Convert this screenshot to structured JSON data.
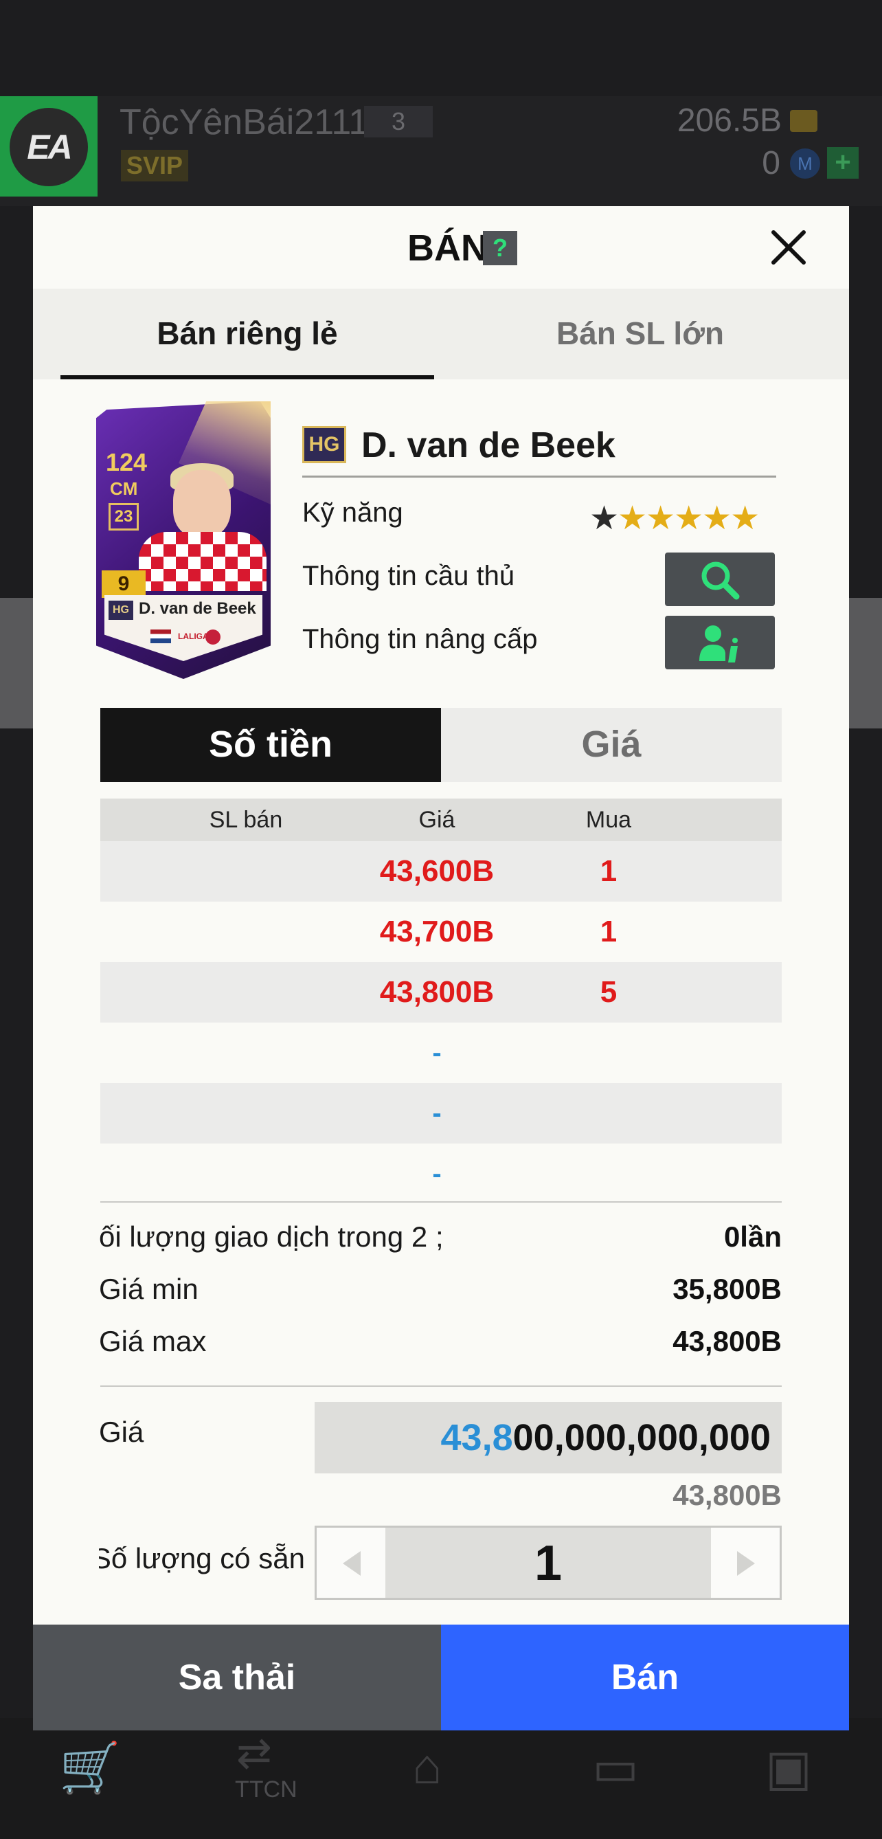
{
  "background": {
    "username": "TộcYênBái2111",
    "level": "3",
    "vip_badge": "SVIP",
    "money": "206.5B",
    "m_coins": "0",
    "nav_label": "TTCN"
  },
  "modal": {
    "title": "BÁN",
    "help": "?",
    "tabs": [
      {
        "label": "Bán riêng lẻ",
        "active": true
      },
      {
        "label": "Bán SL lớn",
        "active": false
      }
    ],
    "card": {
      "ovr": "124",
      "position": "CM",
      "season_badge": "23",
      "grade": "9",
      "hg": "HG",
      "name": "D. van de Beek",
      "league": "LALIGA"
    },
    "player": {
      "hg_badge": "HG",
      "name": "D. van de Beek",
      "skill_label": "Kỹ năng",
      "stars_filled": 5,
      "stars_total": 6,
      "info_label": "Thông tin cầu thủ",
      "upgrade_label": "Thông tin nâng cấp"
    },
    "price_toggle": {
      "amount_label": "Số tiền",
      "price_label": "Giá",
      "active": "amount"
    },
    "table": {
      "headers": [
        "SL bán",
        "Giá",
        "Mua"
      ],
      "rows": [
        {
          "sell": "",
          "price": "43,600B",
          "buy": "1"
        },
        {
          "sell": "",
          "price": "43,700B",
          "buy": "1"
        },
        {
          "sell": "",
          "price": "43,800B",
          "buy": "5"
        },
        {
          "sell": "",
          "price": "-",
          "buy": ""
        },
        {
          "sell": "",
          "price": "-",
          "buy": ""
        },
        {
          "sell": "",
          "price": "-",
          "buy": ""
        }
      ]
    },
    "stats": {
      "trade_count_label": "ối lượng giao dịch trong 2 ;",
      "trade_count_value": "0lần",
      "min_label": "Giá min",
      "min_value": "35,800B",
      "max_label": "Giá max",
      "max_value": "43,800B"
    },
    "price_input": {
      "label": "Giá",
      "value_highlight": "43,8",
      "value_rest": "00,000,000,000",
      "summary": "43,800B"
    },
    "quantity": {
      "label": "Số lượng có sẵn",
      "value": "1"
    },
    "actions": {
      "discard": "Sa thải",
      "sell": "Bán"
    }
  },
  "colors": {
    "sell_button": "#2e64ff",
    "discard_button": "#505357",
    "price_red": "#e01b1b",
    "highlight_blue": "#2a8fd6",
    "star_gold": "#e4ad17",
    "icon_green": "#2fe07a"
  }
}
